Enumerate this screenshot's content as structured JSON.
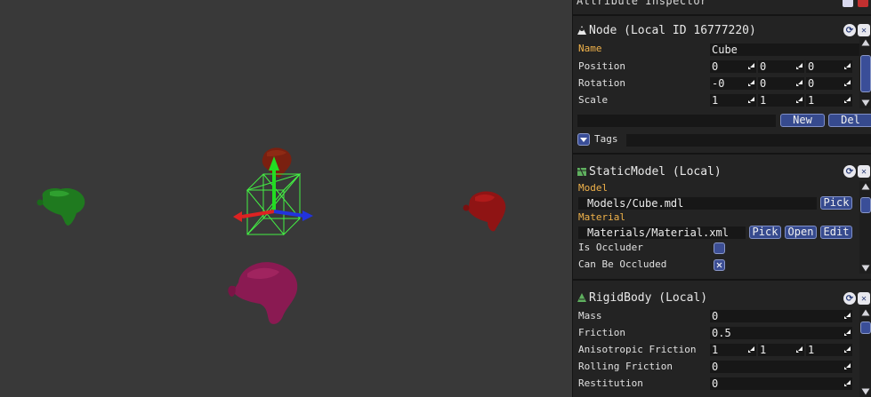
{
  "inspector": {
    "title": "Attribute Inspector"
  },
  "node_panel": {
    "title": "Node (Local ID 16777220)",
    "name_label": "Name",
    "name_value": "Cube",
    "position_label": "Position",
    "position": [
      "0",
      "0",
      "0"
    ],
    "rotation_label": "Rotation",
    "rotation": [
      "-0",
      "0",
      "0"
    ],
    "scale_label": "Scale",
    "scale": [
      "1",
      "1",
      "1"
    ],
    "new_button": "New",
    "del_button": "Del",
    "tags_label": "Tags"
  },
  "static_model_panel": {
    "title": "StaticModel (Local)",
    "model_label": "Model",
    "model_value": "Models/Cube.mdl",
    "material_label": "Material",
    "material_value": "Materials/Material.xml",
    "pick_button": "Pick",
    "open_button": "Open",
    "edit_button": "Edit",
    "is_occluder_label": "Is Occluder",
    "is_occluder_checked": false,
    "can_be_occluded_label": "Can Be Occluded",
    "can_be_occluded_checked": true,
    "checkmark": "✕"
  },
  "rigid_body_panel": {
    "title": "RigidBody (Local)",
    "mass_label": "Mass",
    "mass": "0",
    "friction_label": "Friction",
    "friction": "0.5",
    "anisotropic_friction_label": "Anisotropic Friction",
    "anisotropic_friction": [
      "1",
      "1",
      "1"
    ],
    "rolling_friction_label": "Rolling Friction",
    "rolling_friction": "0",
    "restitution_label": "Restitution",
    "restitution": "0"
  },
  "header_buttons": {
    "reset_glyph": "⟳",
    "close_glyph": "✕"
  },
  "colors": {
    "viewport_bg": "#393939",
    "panel_bg": "#232323",
    "accent_blue": "#364a8e",
    "label_orange": "#f0b24a",
    "monkey_green": "#1f7a1f",
    "monkey_red": "#8f1414",
    "monkey_magenta": "#8a1a52",
    "monkey_dark_red": "#7a2010",
    "gizmo_green": "#22dd22",
    "gizmo_red": "#dd2222",
    "gizmo_blue": "#2233dd",
    "selection_box": "#44ee44"
  }
}
